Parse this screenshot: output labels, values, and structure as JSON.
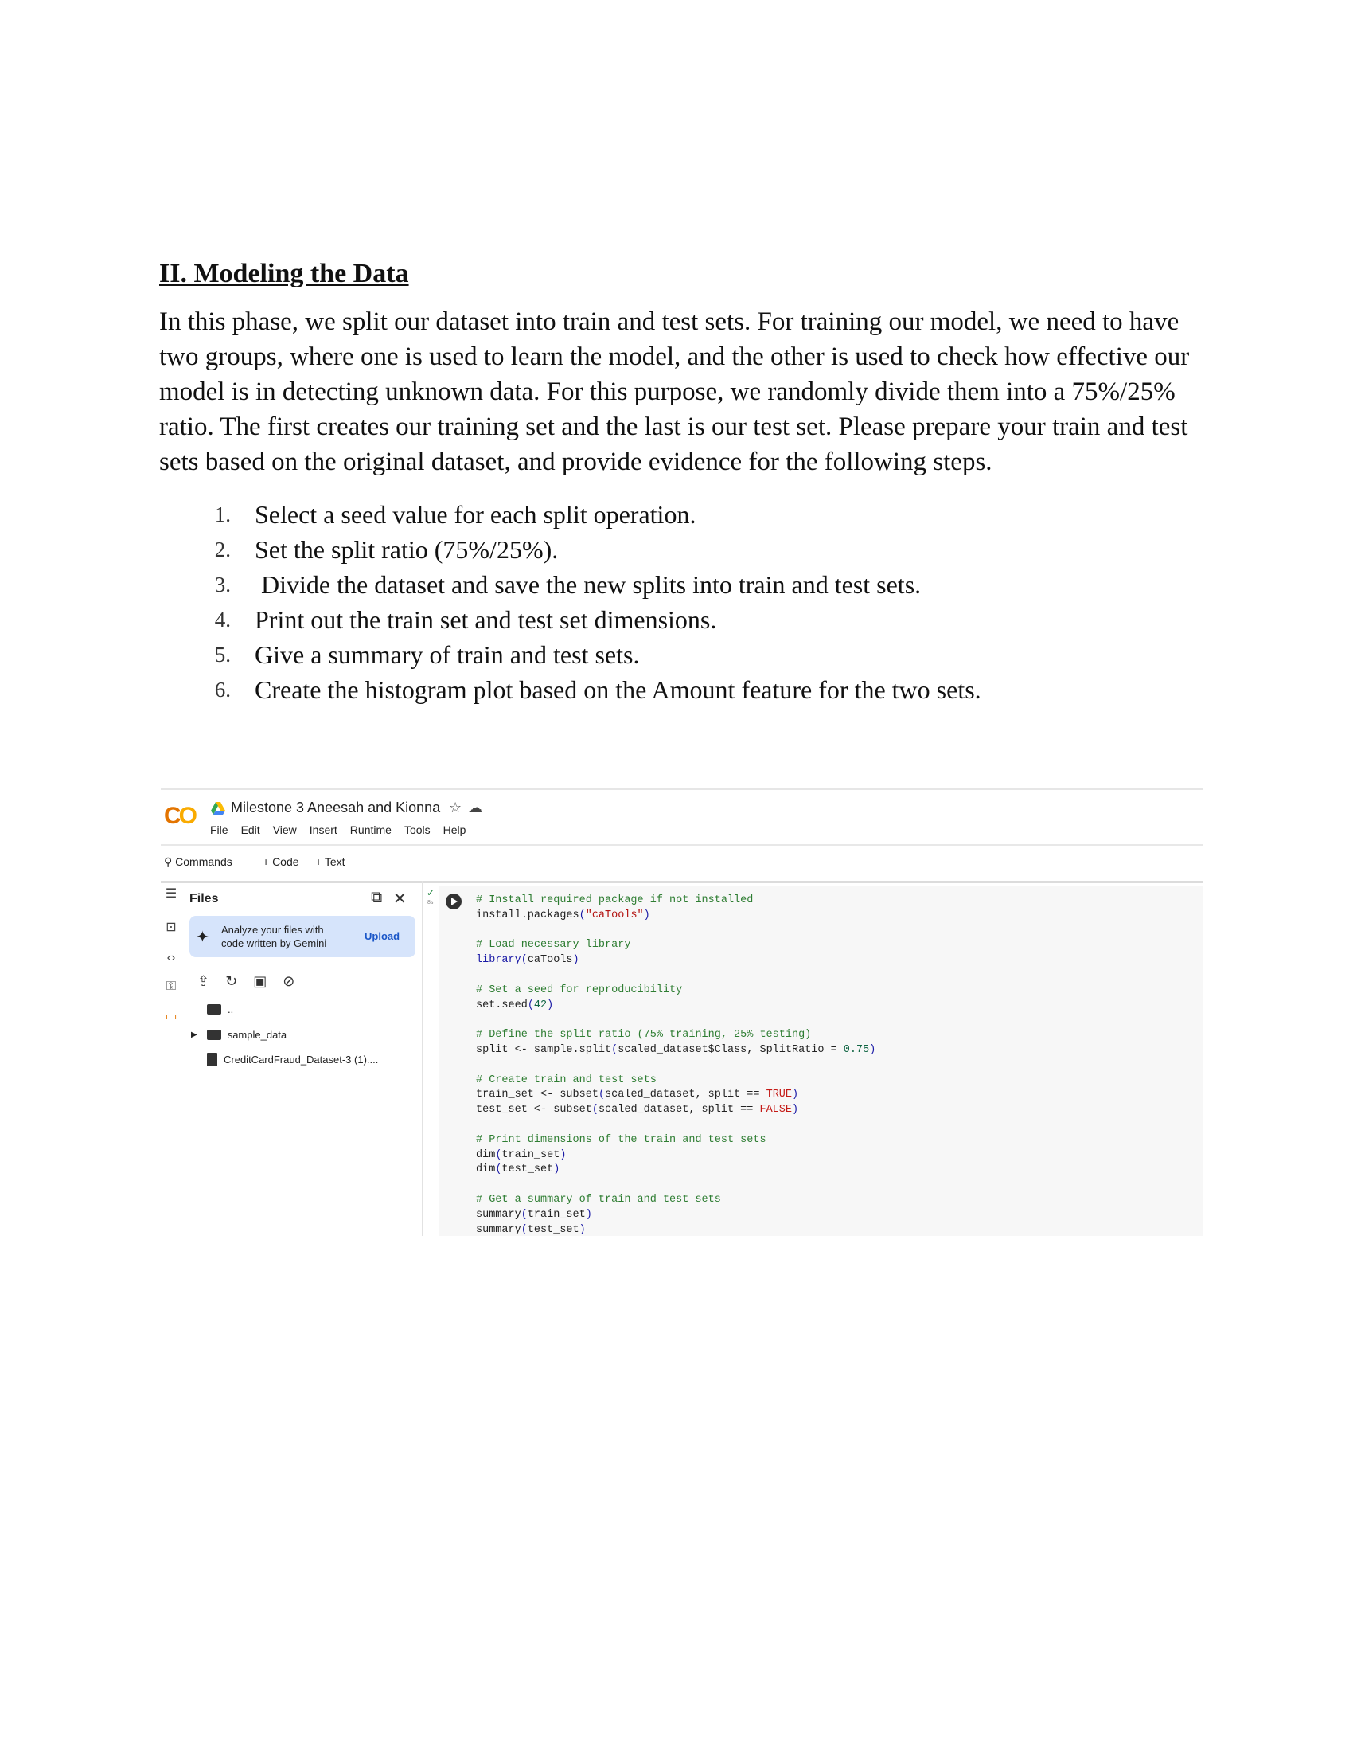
{
  "document": {
    "heading": "II. Modeling the Data",
    "paragraph": "In this phase, we split our dataset into train and test sets. For training our model, we need to have two groups, where one is used to learn the model, and the other is used to check how effective our model is in detecting unknown data. For this purpose, we randomly divide them into a 75%/25% ratio. The first creates our training set and the last is our test set. Please prepare your train and test sets based on the original dataset, and provide evidence for the following steps.",
    "steps": [
      {
        "num": "1.",
        "text": "Select a seed value for each split operation."
      },
      {
        "num": "2.",
        "text": "Set the split ratio (75%/25%)."
      },
      {
        "num": "3.",
        "text": " Divide the dataset and save the new splits into train and test sets."
      },
      {
        "num": "4.",
        "text": "Print out the train set and test set dimensions."
      },
      {
        "num": "5.",
        "text": "Give a summary of train and test sets."
      },
      {
        "num": "6.",
        "text": "Create the histogram plot based on the Amount feature for the two sets."
      }
    ]
  },
  "colab": {
    "logo": {
      "c": "C",
      "o": "O"
    },
    "notebook_title": "Milestone 3 Aneesah and Kionna",
    "title_icons": [
      "star-icon",
      "cloud-icon"
    ],
    "menu": [
      "File",
      "Edit",
      "View",
      "Insert",
      "Runtime",
      "Tools",
      "Help"
    ],
    "toolbar": {
      "commands": "Commands",
      "code": "+ Code",
      "text": "+ Text"
    },
    "files_panel": {
      "title": "Files",
      "gemini_message": "Analyze your files with code written by Gemini",
      "upload_label": "Upload",
      "parent_dir": "..",
      "folder": "sample_data",
      "file": "CreditCardFraud_Dataset-3 (1)...."
    },
    "cell": {
      "exec_time": "8s",
      "code_lines": [
        [
          {
            "t": "# Install required package if not installed",
            "c": "cm"
          }
        ],
        [
          {
            "t": "install.packages",
            "c": ""
          },
          {
            "t": "(",
            "c": "par"
          },
          {
            "t": "\"caTools\"",
            "c": "str"
          },
          {
            "t": ")",
            "c": "par"
          }
        ],
        [],
        [
          {
            "t": "# Load necessary library",
            "c": "cm"
          }
        ],
        [
          {
            "t": "library",
            "c": "kw"
          },
          {
            "t": "(",
            "c": "par"
          },
          {
            "t": "caTools",
            "c": ""
          },
          {
            "t": ")",
            "c": "par"
          }
        ],
        [],
        [
          {
            "t": "# Set a seed for reproducibility",
            "c": "cm"
          }
        ],
        [
          {
            "t": "set.seed",
            "c": ""
          },
          {
            "t": "(",
            "c": "par"
          },
          {
            "t": "42",
            "c": "num"
          },
          {
            "t": ")",
            "c": "par"
          }
        ],
        [],
        [
          {
            "t": "# Define the split ratio (75% training, 25% testing)",
            "c": "cm"
          }
        ],
        [
          {
            "t": "split <- sample.split",
            "c": ""
          },
          {
            "t": "(",
            "c": "par"
          },
          {
            "t": "scaled_dataset$Class, SplitRatio = ",
            "c": ""
          },
          {
            "t": "0.75",
            "c": "num"
          },
          {
            "t": ")",
            "c": "par"
          }
        ],
        [],
        [
          {
            "t": "# Create train and test sets",
            "c": "cm"
          }
        ],
        [
          {
            "t": "train_set <- subset",
            "c": ""
          },
          {
            "t": "(",
            "c": "par"
          },
          {
            "t": "scaled_dataset, split == ",
            "c": ""
          },
          {
            "t": "TRUE",
            "c": "bool"
          },
          {
            "t": ")",
            "c": "par"
          }
        ],
        [
          {
            "t": "test_set <- subset",
            "c": ""
          },
          {
            "t": "(",
            "c": "par"
          },
          {
            "t": "scaled_dataset, split == ",
            "c": ""
          },
          {
            "t": "FALSE",
            "c": "bool"
          },
          {
            "t": ")",
            "c": "par"
          }
        ],
        [],
        [
          {
            "t": "# Print dimensions of the train and test sets",
            "c": "cm"
          }
        ],
        [
          {
            "t": "dim",
            "c": ""
          },
          {
            "t": "(",
            "c": "par"
          },
          {
            "t": "train_set",
            "c": ""
          },
          {
            "t": ")",
            "c": "par"
          }
        ],
        [
          {
            "t": "dim",
            "c": ""
          },
          {
            "t": "(",
            "c": "par"
          },
          {
            "t": "test_set",
            "c": ""
          },
          {
            "t": ")",
            "c": "par"
          }
        ],
        [],
        [
          {
            "t": "# Get a summary of train and test sets",
            "c": "cm"
          }
        ],
        [
          {
            "t": "summary",
            "c": ""
          },
          {
            "t": "(",
            "c": "par"
          },
          {
            "t": "train_set",
            "c": ""
          },
          {
            "t": ")",
            "c": "par"
          }
        ],
        [
          {
            "t": "summary",
            "c": ""
          },
          {
            "t": "(",
            "c": "par"
          },
          {
            "t": "test_set",
            "c": ""
          },
          {
            "t": ")",
            "c": "par"
          }
        ]
      ]
    }
  }
}
